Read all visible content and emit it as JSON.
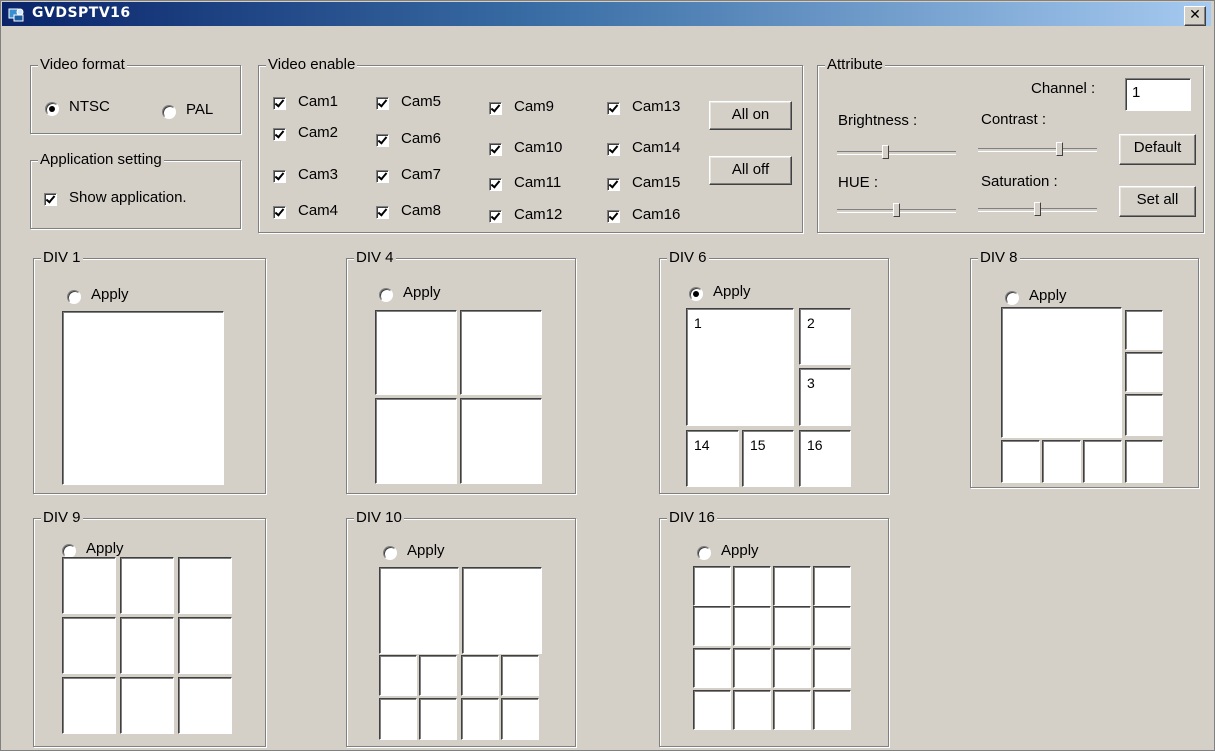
{
  "window": {
    "title": "GVDSPTV16",
    "close_glyph": "✕"
  },
  "video_format": {
    "legend": "Video format",
    "options": [
      {
        "label": "NTSC",
        "selected": true
      },
      {
        "label": "PAL",
        "selected": false
      }
    ]
  },
  "application_setting": {
    "legend": "Application setting",
    "checkbox_label": "Show application.",
    "checked": true
  },
  "video_enable": {
    "legend": "Video enable",
    "cams": [
      "Cam1",
      "Cam2",
      "Cam3",
      "Cam4",
      "Cam5",
      "Cam6",
      "Cam7",
      "Cam8",
      "Cam9",
      "Cam10",
      "Cam11",
      "Cam12",
      "Cam13",
      "Cam14",
      "Cam15",
      "Cam16"
    ],
    "all_checked": true,
    "all_on_label": "All on",
    "all_off_label": "All off"
  },
  "attribute": {
    "legend": "Attribute",
    "channel_label": "Channel :",
    "channel_value": "1",
    "brightness_label": "Brightness :",
    "contrast_label": "Contrast :",
    "hue_label": "HUE :",
    "saturation_label": "Saturation :",
    "default_label": "Default",
    "set_all_label": "Set all",
    "slider_levels": {
      "brightness": 0.4,
      "contrast": 0.7,
      "hue": 0.5,
      "saturation": 0.5
    }
  },
  "divisions": [
    {
      "legend": "DIV 1",
      "apply_label": "Apply",
      "selected": false
    },
    {
      "legend": "DIV 4",
      "apply_label": "Apply",
      "selected": false
    },
    {
      "legend": "DIV 6",
      "apply_label": "Apply",
      "selected": true,
      "cell_numbers": [
        "1",
        "2",
        "3",
        "14",
        "15",
        "16"
      ]
    },
    {
      "legend": "DIV 8",
      "apply_label": "Apply",
      "selected": false
    },
    {
      "legend": "DIV 9",
      "apply_label": "Apply",
      "selected": false
    },
    {
      "legend": "DIV 10",
      "apply_label": "Apply",
      "selected": false
    },
    {
      "legend": "DIV 16",
      "apply_label": "Apply",
      "selected": false
    }
  ]
}
